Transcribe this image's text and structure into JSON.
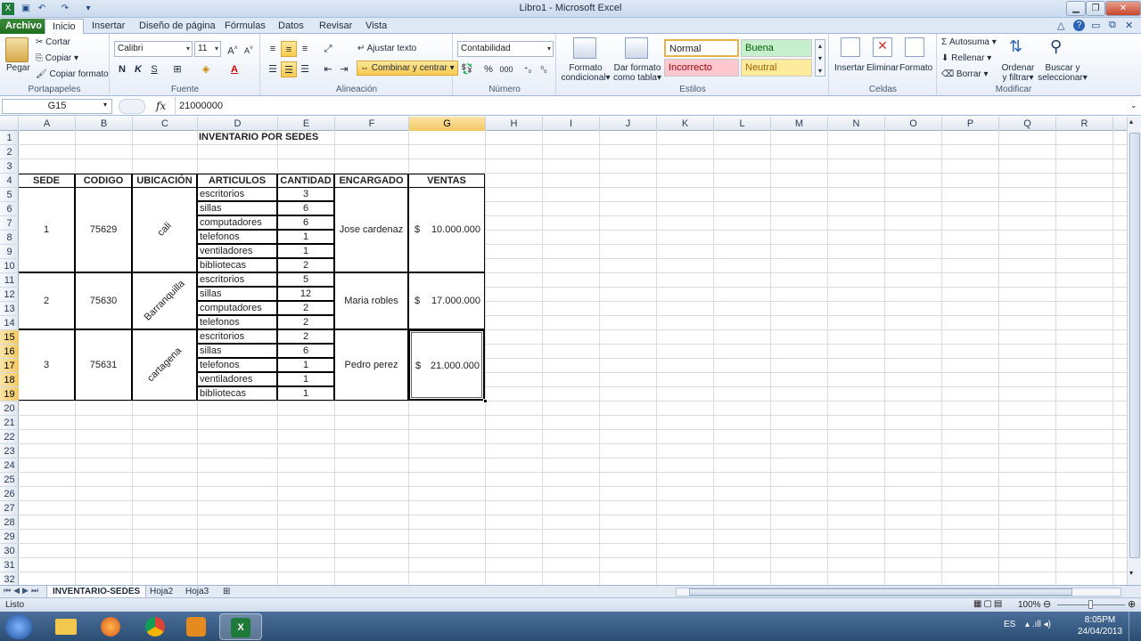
{
  "window": {
    "title": "Libro1  -  Microsoft Excel"
  },
  "tabs": [
    "Archivo",
    "Inicio",
    "Insertar",
    "Diseño de página",
    "Fórmulas",
    "Datos",
    "Revisar",
    "Vista"
  ],
  "ribbon": {
    "clipboard": {
      "paste": "Pegar",
      "cut": "Cortar",
      "copy": "Copiar",
      "format_painter": "Copiar formato",
      "label": "Portapapeles"
    },
    "font": {
      "name": "Calibri",
      "size": "11",
      "label": "Fuente"
    },
    "alignment": {
      "wrap": "Ajustar texto",
      "merge": "Combinar y centrar",
      "label": "Alineación"
    },
    "number": {
      "format": "Contabilidad",
      "label": "Número",
      "percent": "%",
      "thousands": "000"
    },
    "styles": {
      "cond_format": [
        "Formato",
        "condicional"
      ],
      "table_format": [
        "Dar formato",
        "como tabla"
      ],
      "items": [
        {
          "name": "Normal",
          "bg": "#ffffff"
        },
        {
          "name": "Buena",
          "bg": "#c6efce"
        },
        {
          "name": "Incorrecto",
          "bg": "#ffc7ce"
        },
        {
          "name": "Neutral",
          "bg": "#ffeb9c"
        }
      ],
      "label": "Estilos"
    },
    "cells": {
      "insert": "Insertar",
      "delete": "Eliminar",
      "format": "Formato",
      "label": "Celdas"
    },
    "editing": {
      "autosum": "Autosuma",
      "fill": "Rellenar",
      "clear": "Borrar",
      "sort": [
        "Ordenar",
        "y filtrar"
      ],
      "find": [
        "Buscar y",
        "seleccionar"
      ],
      "label": "Modificar"
    }
  },
  "formula_bar": {
    "name_box": "G15",
    "fx": "fx",
    "value": "21000000"
  },
  "columns": [
    "A",
    "B",
    "C",
    "D",
    "E",
    "F",
    "G",
    "H",
    "I",
    "J",
    "K",
    "L",
    "M",
    "N",
    "O",
    "P",
    "Q",
    "R"
  ],
  "selected_column": "G",
  "row_count": 32,
  "selected_rows": [
    15,
    16,
    17,
    18,
    19
  ],
  "sheet": {
    "title": "INVENTARIO POR SEDES",
    "headers": [
      "SEDE",
      "CODIGO",
      "UBICACIÓN",
      "ARTICULOS",
      "CANTIDAD",
      "ENCARGADO",
      "VENTAS"
    ],
    "groups": [
      {
        "sede": "1",
        "codigo": "75629",
        "ubicacion": "cali",
        "encargado": "Jose cardenaz",
        "currency": "$",
        "ventas": "10.000.000",
        "items": [
          [
            "escritorios",
            "3"
          ],
          [
            "sillas",
            "6"
          ],
          [
            "computadores",
            "6"
          ],
          [
            "telefonos",
            "1"
          ],
          [
            "ventiladores",
            "1"
          ],
          [
            "bibliotecas",
            "2"
          ]
        ]
      },
      {
        "sede": "2",
        "codigo": "75630",
        "ubicacion": "Barranquilla",
        "encargado": "Maria robles",
        "currency": "$",
        "ventas": "17.000.000",
        "items": [
          [
            "escritorios",
            "5"
          ],
          [
            "sillas",
            "12"
          ],
          [
            "computadores",
            "2"
          ],
          [
            "telefonos",
            "2"
          ]
        ]
      },
      {
        "sede": "3",
        "codigo": "75631",
        "ubicacion": "cartagena",
        "encargado": "Pedro perez",
        "currency": "$",
        "ventas": "21.000.000",
        "items": [
          [
            "escritorios",
            "2"
          ],
          [
            "sillas",
            "6"
          ],
          [
            "telefonos",
            "1"
          ],
          [
            "ventiladores",
            "1"
          ],
          [
            "bibliotecas",
            "1"
          ]
        ]
      }
    ]
  },
  "sheet_tabs": [
    "INVENTARIO-SEDES",
    "Hoja2",
    "Hoja3"
  ],
  "status": {
    "ready": "Listo",
    "zoom": "100%"
  },
  "taskbar": {
    "lang": "ES",
    "time": "8:05PM",
    "date": "24/04/2013"
  }
}
